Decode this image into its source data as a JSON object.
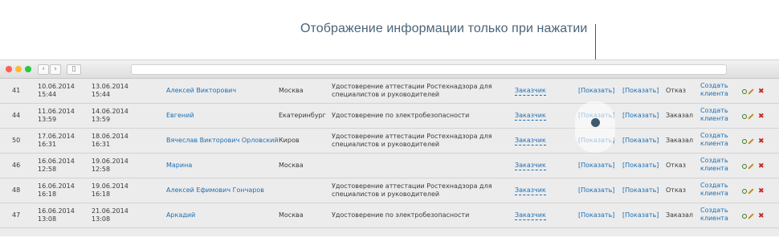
{
  "annotation": "Отображение информации только при нажатии",
  "rows": [
    {
      "id": "41",
      "created_date": "10.06.2014",
      "created_time": "15:44",
      "updated_date": "13.06.2014",
      "updated_time": "15:44",
      "name": "Алексей Викторович",
      "city": "Москва",
      "service_line1": "Удостоверение аттестации Ростехнадзора для",
      "service_line2": "специалистов и руководителей",
      "role": "Заказчик",
      "show1": "[Показать]",
      "show2": "[Показать]",
      "status": "Отказ",
      "create1": "Создать",
      "create2": "клиента"
    },
    {
      "id": "44",
      "created_date": "11.06.2014",
      "created_time": "13:59",
      "updated_date": "14.06.2014",
      "updated_time": "13:59",
      "name": "Евгений",
      "city": "Екатеринбург",
      "service_line1": "Удостоверение по электробезопасности",
      "service_line2": "",
      "role": "Заказчик",
      "show1": "[Показать]",
      "show2": "[Показать]",
      "status": "Заказал",
      "create1": "Создать",
      "create2": "клиента"
    },
    {
      "id": "50",
      "created_date": "17.06.2014",
      "created_time": "16:31",
      "updated_date": "18.06.2014",
      "updated_time": "16:31",
      "name": "Вячеслав Викторович Орловский",
      "city": "Киров",
      "service_line1": "Удостоверение аттестации Ростехнадзора для",
      "service_line2": "специалистов и руководителей",
      "role": "Заказчик",
      "show1": "[Показать]",
      "show2": "[Показать]",
      "status": "Заказал",
      "create1": "Создать",
      "create2": "клиента"
    },
    {
      "id": "46",
      "created_date": "16.06.2014",
      "created_time": "12:58",
      "updated_date": "19.06.2014",
      "updated_time": "12:58",
      "name": "Марина",
      "city": "Москва",
      "service_line1": "",
      "service_line2": "",
      "role": "Заказчик",
      "show1": "[Показать]",
      "show2": "[Показать]",
      "status": "Отказ",
      "create1": "Создать",
      "create2": "клиента"
    },
    {
      "id": "48",
      "created_date": "16.06.2014",
      "created_time": "16:18",
      "updated_date": "19.06.2014",
      "updated_time": "16:18",
      "name": "Алексей Ефимович Гончаров",
      "city": "",
      "service_line1": "Удостоверение аттестации Ростехнадзора для",
      "service_line2": "специалистов и руководителей",
      "role": "Заказчик",
      "show1": "[Показать]",
      "show2": "[Показать]",
      "status": "Отказ",
      "create1": "Создать",
      "create2": "клиента"
    },
    {
      "id": "47",
      "created_date": "16.06.2014",
      "created_time": "13:08",
      "updated_date": "21.06.2014",
      "updated_time": "13:08",
      "name": "Аркадий",
      "city": "Москва",
      "service_line1": "Удостоверение по электробезопасности",
      "service_line2": "",
      "role": "Заказчик",
      "show1": "[Показать]",
      "show2": "[Показать]",
      "status": "Заказал",
      "create1": "Создать",
      "create2": "клиента"
    }
  ],
  "window_controls": {
    "close_color": "#ff5f57",
    "minimize_color": "#febc2e",
    "maximize_color": "#28c840"
  },
  "nav": {
    "back_icon": "chevron-left-icon",
    "forward_icon": "chevron-right-icon",
    "sidebar_icon": "sidebar-icon"
  },
  "colors": {
    "link": "#1d6fb5",
    "callout": "#3e5a6e",
    "annotation_text": "#4a6478"
  }
}
